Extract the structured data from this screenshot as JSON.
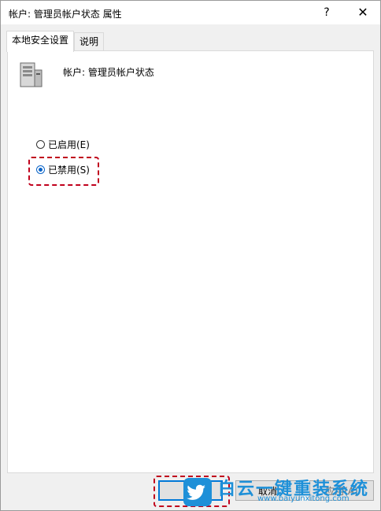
{
  "window": {
    "title": "帐户: 管理员帐户状态 属性",
    "help_label": "?",
    "close_label": "✕"
  },
  "tabs": [
    {
      "label": "本地安全设置",
      "active": true
    },
    {
      "label": "说明",
      "active": false
    }
  ],
  "policy": {
    "icon": "server-computer-icon",
    "title": "帐户: 管理员帐户状态"
  },
  "options": [
    {
      "label": "已启用(E)",
      "checked": false
    },
    {
      "label": "已禁用(S)",
      "checked": true
    }
  ],
  "buttons": {
    "ok": "",
    "cancel": "取消",
    "apply": "应用(A)"
  },
  "watermark": {
    "icon": "twitter-bird-icon",
    "title": "白云一键重装系统",
    "url": "www.baiyunxitong.com"
  },
  "colors": {
    "accent": "#0078d7",
    "highlight": "#c0001c",
    "watermark": "#1e90d8"
  }
}
